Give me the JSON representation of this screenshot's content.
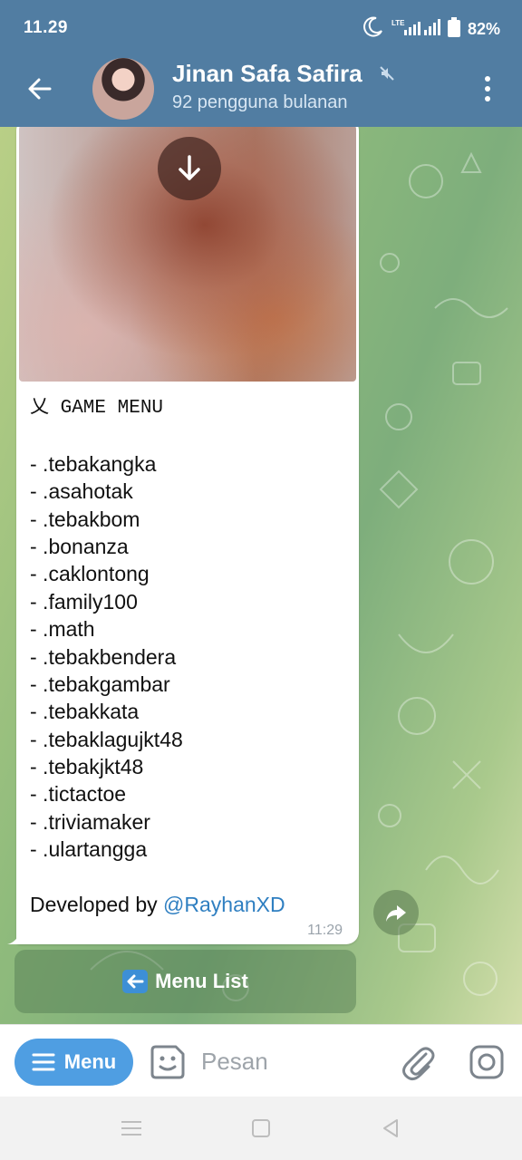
{
  "status_bar": {
    "time": "11.29",
    "network": "LTE",
    "battery": "82%"
  },
  "header": {
    "title": "Jinan Safa Safira",
    "subtitle": "92 pengguna bulanan"
  },
  "message": {
    "menu_title": "乂 GAME MENU",
    "items": [
      "- .tebakangka",
      "- .asahotak",
      "- .tebakbom",
      "- .bonanza",
      "- .caklontong",
      "- .family100",
      "- .math",
      "- .tebakbendera",
      "- .tebakgambar",
      "- .tebakkata",
      "- .tebaklagujkt48",
      "- .tebakjkt48",
      "- .tictactoe",
      "- .triviamaker",
      "- .ulartangga"
    ],
    "developed_by": "Developed by ",
    "mention": "@RayhanXD",
    "time": "11:29"
  },
  "keyboard": {
    "button_label": "Menu List",
    "button_icon": "left-arrow-emoji"
  },
  "input_bar": {
    "menu_label": "Menu",
    "placeholder": "Pesan"
  },
  "colors": {
    "header": "#517da2",
    "menu_button": "#4f9ee2",
    "mention": "#2f7fc1"
  }
}
